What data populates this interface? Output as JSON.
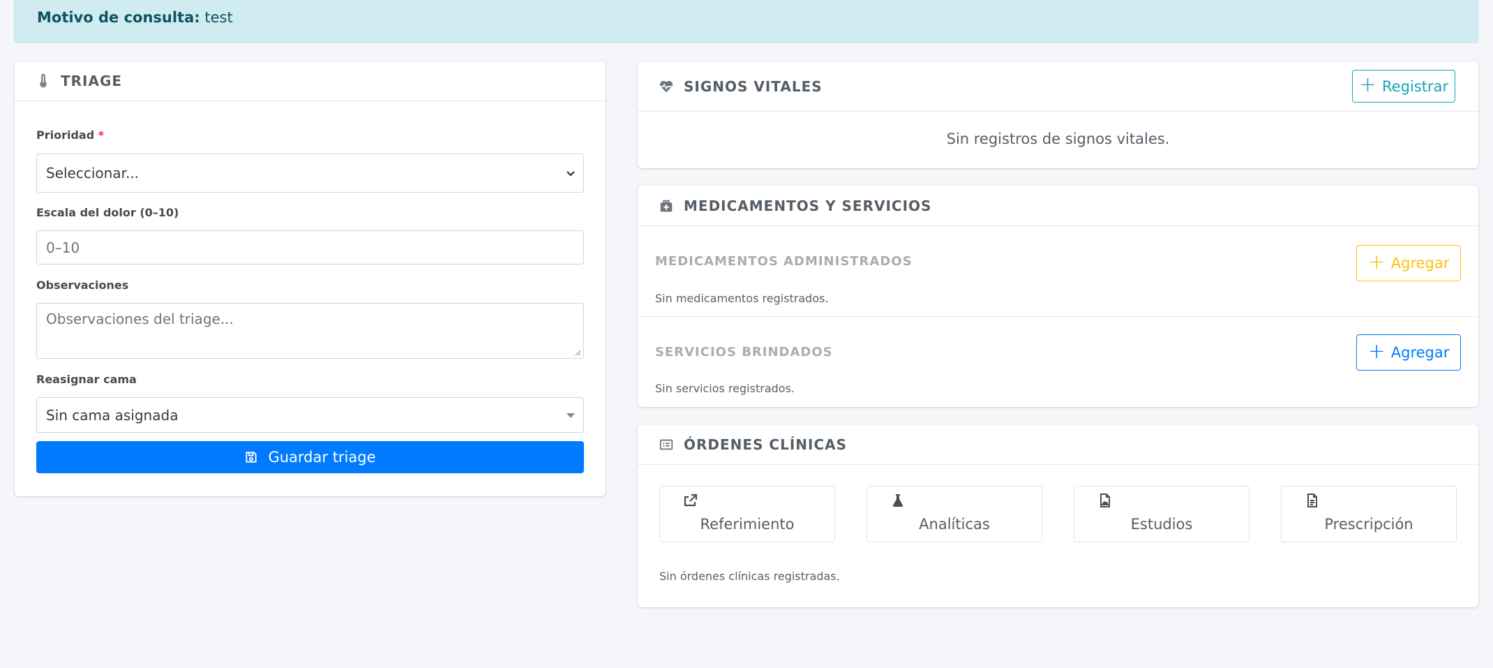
{
  "alert": {
    "label": "Motivo de consulta:",
    "value": "test"
  },
  "triage": {
    "title": "TRIAGE",
    "priority_label": "Prioridad",
    "priority_required": "*",
    "priority_value": "Seleccionar...",
    "pain_label": "Escala del dolor (0–10)",
    "pain_placeholder": "0–10",
    "observations_label": "Observaciones",
    "observations_placeholder": "Observaciones del triage...",
    "bed_label": "Reasignar cama",
    "bed_value": "Sin cama asignada",
    "save_label": "Guardar triage"
  },
  "vitals": {
    "title": "SIGNOS VITALES",
    "register_label": "Registrar",
    "empty": "Sin registros de signos vitales."
  },
  "meds": {
    "title": "MEDICAMENTOS Y SERVICIOS",
    "administered_title": "MEDICAMENTOS ADMINISTRADOS",
    "administered_add": "Agregar",
    "administered_empty": "Sin medicamentos registrados.",
    "services_title": "SERVICIOS BRINDADOS",
    "services_add": "Agregar",
    "services_empty": "Sin servicios registrados."
  },
  "orders": {
    "title": "ÓRDENES CLÍNICAS",
    "tiles": [
      {
        "label": "Referimiento",
        "icon": "share-square-icon"
      },
      {
        "label": "Analíticas",
        "icon": "flask-icon"
      },
      {
        "label": "Estudios",
        "icon": "file-image-icon"
      },
      {
        "label": "Prescripción",
        "icon": "file-text-icon"
      }
    ],
    "empty": "Sin órdenes clínicas registradas."
  },
  "colors": {
    "primary": "#007bff",
    "info": "#17a2b8",
    "warning": "#ffc107",
    "alert_bg": "#d1ecf1",
    "alert_text": "#0c5460"
  }
}
